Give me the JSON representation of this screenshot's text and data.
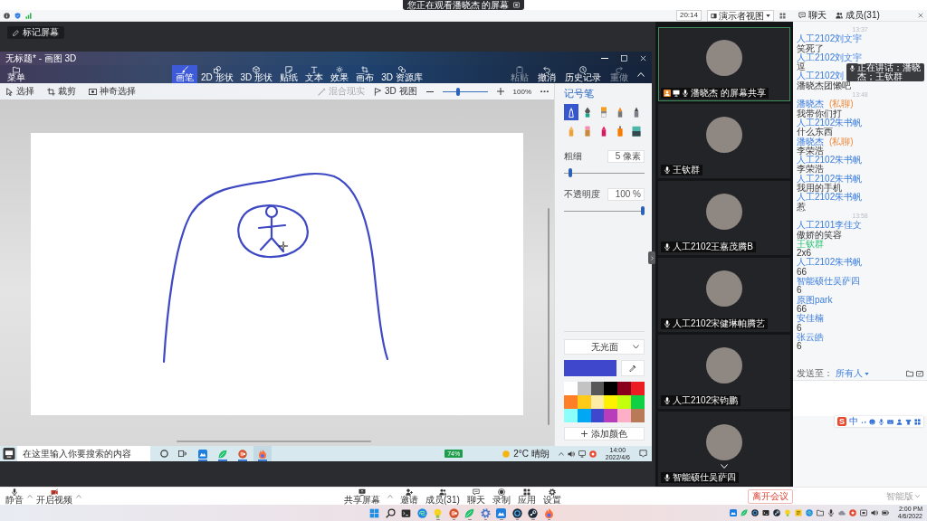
{
  "viewer_banner": {
    "text": "您正在观看潘晓杰 的屏幕"
  },
  "top_bar": {
    "timer": "20:14",
    "view_mode": "演示者视图",
    "chat_tab": "聊天",
    "members_tab": "成员(31)"
  },
  "annotate_button": "标记屏幕",
  "paint": {
    "title": "无标题* - 画图 3D",
    "menu": "菜单",
    "tools": [
      {
        "label": "画笔",
        "kind": "brush",
        "selected": true
      },
      {
        "label": "2D 形状",
        "kind": "shape2d",
        "selected": false
      },
      {
        "label": "3D 形状",
        "kind": "shape3d",
        "selected": false
      },
      {
        "label": "贴纸",
        "kind": "sticker",
        "selected": false
      },
      {
        "label": "文本",
        "kind": "text",
        "selected": false
      },
      {
        "label": "效果",
        "kind": "effects",
        "selected": false
      },
      {
        "label": "画布",
        "kind": "canvas",
        "selected": false
      },
      {
        "label": "3D 资源库",
        "kind": "library",
        "selected": false
      }
    ],
    "actions": [
      {
        "label": "粘贴",
        "kind": "paste",
        "disabled": true
      },
      {
        "label": "撤消",
        "kind": "undo",
        "disabled": false
      },
      {
        "label": "历史记录",
        "kind": "history",
        "disabled": false
      },
      {
        "label": "重做",
        "kind": "redo",
        "disabled": true
      }
    ],
    "select_tools": [
      {
        "label": "选择",
        "kind": "select"
      },
      {
        "label": "裁剪",
        "kind": "crop"
      },
      {
        "label": "神奇选择",
        "kind": "magic"
      }
    ],
    "mixed_reality": {
      "label": "混合现实",
      "disabled": true
    },
    "view_3d": "3D 视图",
    "zoom": {
      "level": 0.33,
      "reading": "100%"
    },
    "panel": {
      "title": "记号笔",
      "brushes": [
        {
          "kind": "marker",
          "selected": true
        },
        {
          "kind": "calligraphy",
          "selected": false
        },
        {
          "kind": "oil",
          "selected": false
        },
        {
          "kind": "watercolor",
          "selected": false
        },
        {
          "kind": "pixel",
          "selected": false
        },
        {
          "kind": "pencil",
          "selected": false
        },
        {
          "kind": "eraser",
          "selected": false
        },
        {
          "kind": "crayon",
          "selected": false
        },
        {
          "kind": "spray",
          "selected": false
        },
        {
          "kind": "fill",
          "selected": false
        }
      ],
      "thickness": {
        "label": "粗细",
        "value": "5 像素",
        "level": 0.06
      },
      "opacity": {
        "label": "不透明度",
        "value": "100 %",
        "level": 1
      },
      "finish": "无光面",
      "current": {
        "color": "#3f48cc"
      },
      "palette": [
        {
          "color": "#ffffff"
        },
        {
          "color": "#c3c3c3"
        },
        {
          "color": "#585858"
        },
        {
          "color": "#000000"
        },
        {
          "color": "#88001b"
        },
        {
          "color": "#ec1c24"
        },
        {
          "color": "#ff7f27"
        },
        {
          "color": "#ffca18"
        },
        {
          "color": "#fdeca6"
        },
        {
          "color": "#fff200"
        },
        {
          "color": "#c4ff0e"
        },
        {
          "color": "#0ed145"
        },
        {
          "color": "#8cfffb"
        },
        {
          "color": "#00a8f3"
        },
        {
          "color": "#3f48cc"
        },
        {
          "color": "#b83dba"
        },
        {
          "color": "#ffaec8"
        },
        {
          "color": "#b97a57"
        }
      ],
      "add_color": "添加颜色"
    }
  },
  "shared_taskbar": {
    "search": "在这里输入你要搜索的内容",
    "apps": [
      {
        "kind": "tile",
        "running": true,
        "selected": false
      },
      {
        "kind": "leaf",
        "running": true,
        "selected": false
      },
      {
        "kind": "slides",
        "running": true,
        "selected": false
      },
      {
        "kind": "flame",
        "running": true,
        "selected": true
      }
    ],
    "badge": "74%",
    "weather": "2°C 晴朗",
    "time": "14:00",
    "date": "2022/4/6"
  },
  "video_tiles": [
    {
      "name": "潘晓杰 的屏幕共享",
      "speaking": true,
      "host": true
    },
    {
      "name": "王钦群",
      "speaking": false,
      "host": false
    },
    {
      "name": "人工2102王嘉茂腾B",
      "speaking": false,
      "host": false
    },
    {
      "name": "人工2102宋健琳帕腾艺",
      "speaking": false,
      "host": false
    },
    {
      "name": "人工2102宋钧鹏",
      "speaking": false,
      "host": false
    },
    {
      "name": "智能硕仕吴萨四",
      "speaking": false,
      "host": false
    }
  ],
  "chat": {
    "items": [
      {
        "kind": "time",
        "text": "13:37"
      },
      {
        "kind": "message",
        "sender": "人工2102刘文宇",
        "accent": false,
        "text": "笑死了"
      },
      {
        "kind": "message",
        "sender": "人工2102刘文宇",
        "accent": false,
        "text": "逗"
      },
      {
        "kind": "message",
        "sender": "人工2102刘",
        "accent": false,
        "text": "潘晓杰团懒吧"
      },
      {
        "kind": "time",
        "text": "13:48"
      },
      {
        "kind": "message",
        "sender": "潘晓杰",
        "accent": false,
        "tag": "(私聊)",
        "text": "我带你们打"
      },
      {
        "kind": "message",
        "sender": "人工2102朱书帆",
        "accent": false,
        "text": "什么东西"
      },
      {
        "kind": "message",
        "sender": "潘晓杰",
        "accent": false,
        "tag": "(私聊)",
        "text": "李荣浩"
      },
      {
        "kind": "message",
        "sender": "人工2102朱书帆",
        "accent": false,
        "text": "李荣浩"
      },
      {
        "kind": "message",
        "sender": "人工2102朱书帆",
        "accent": false,
        "text": "我用的手机"
      },
      {
        "kind": "message",
        "sender": "人工2102朱书帆",
        "accent": false,
        "text": "惹"
      },
      {
        "kind": "time",
        "text": "13:58"
      },
      {
        "kind": "message",
        "sender": "人工2101李佳文",
        "accent": false,
        "text": "傲娇的笑容"
      },
      {
        "kind": "message",
        "sender": "王钦群",
        "accent": true,
        "text": "2x6"
      },
      {
        "kind": "message",
        "sender": "人工2102朱书帆",
        "accent": false,
        "text": "66"
      },
      {
        "kind": "message",
        "sender": "智能硕仕吴萨四",
        "accent": false,
        "text": "6"
      },
      {
        "kind": "message",
        "sender": "原图park",
        "accent": false,
        "text": "66"
      },
      {
        "kind": "message",
        "sender": "安佳楠",
        "accent": false,
        "text": "6"
      },
      {
        "kind": "message",
        "sender": "张云皓",
        "accent": false,
        "text": "6"
      }
    ],
    "speaking_tip": "正在讲话：潘晓杰；王钦群",
    "send_to_label": "发送至：",
    "send_to": "所有人",
    "ime": {
      "logo": "S",
      "mode": "中"
    }
  },
  "meeting_toolbar": {
    "left": [
      {
        "label": "静音",
        "kind": "mic",
        "menu": true
      },
      {
        "label": "开启视频",
        "kind": "camera_off",
        "menu": true
      }
    ],
    "center": [
      {
        "label": "共享屏幕",
        "kind": "share",
        "menu": true
      },
      {
        "label": "邀请",
        "kind": "invite",
        "menu": false
      },
      {
        "label": "成员(31)",
        "kind": "members",
        "menu": false
      },
      {
        "label": "聊天",
        "kind": "chat",
        "menu": false
      },
      {
        "label": "录制",
        "kind": "record",
        "menu": false
      },
      {
        "label": "应用",
        "kind": "apps",
        "menu": false
      },
      {
        "label": "设置",
        "kind": "settings",
        "menu": false
      }
    ],
    "leave": "离开会议",
    "mode": "智能版"
  },
  "taskbar": {
    "apps": [
      {
        "kind": "start",
        "running": false
      },
      {
        "kind": "search",
        "running": false
      },
      {
        "kind": "terminal",
        "running": false
      },
      {
        "kind": "swirl",
        "running": false
      },
      {
        "kind": "bulb",
        "running": true
      },
      {
        "kind": "slides",
        "running": true
      },
      {
        "kind": "leaf",
        "running": true
      },
      {
        "kind": "gear",
        "running": true
      },
      {
        "kind": "tile",
        "running": true
      },
      {
        "kind": "ring_app",
        "running": true
      },
      {
        "kind": "disc",
        "running": true
      },
      {
        "kind": "flame",
        "running": true
      }
    ],
    "time": "2:00 PM",
    "date": "4/6/2022"
  }
}
